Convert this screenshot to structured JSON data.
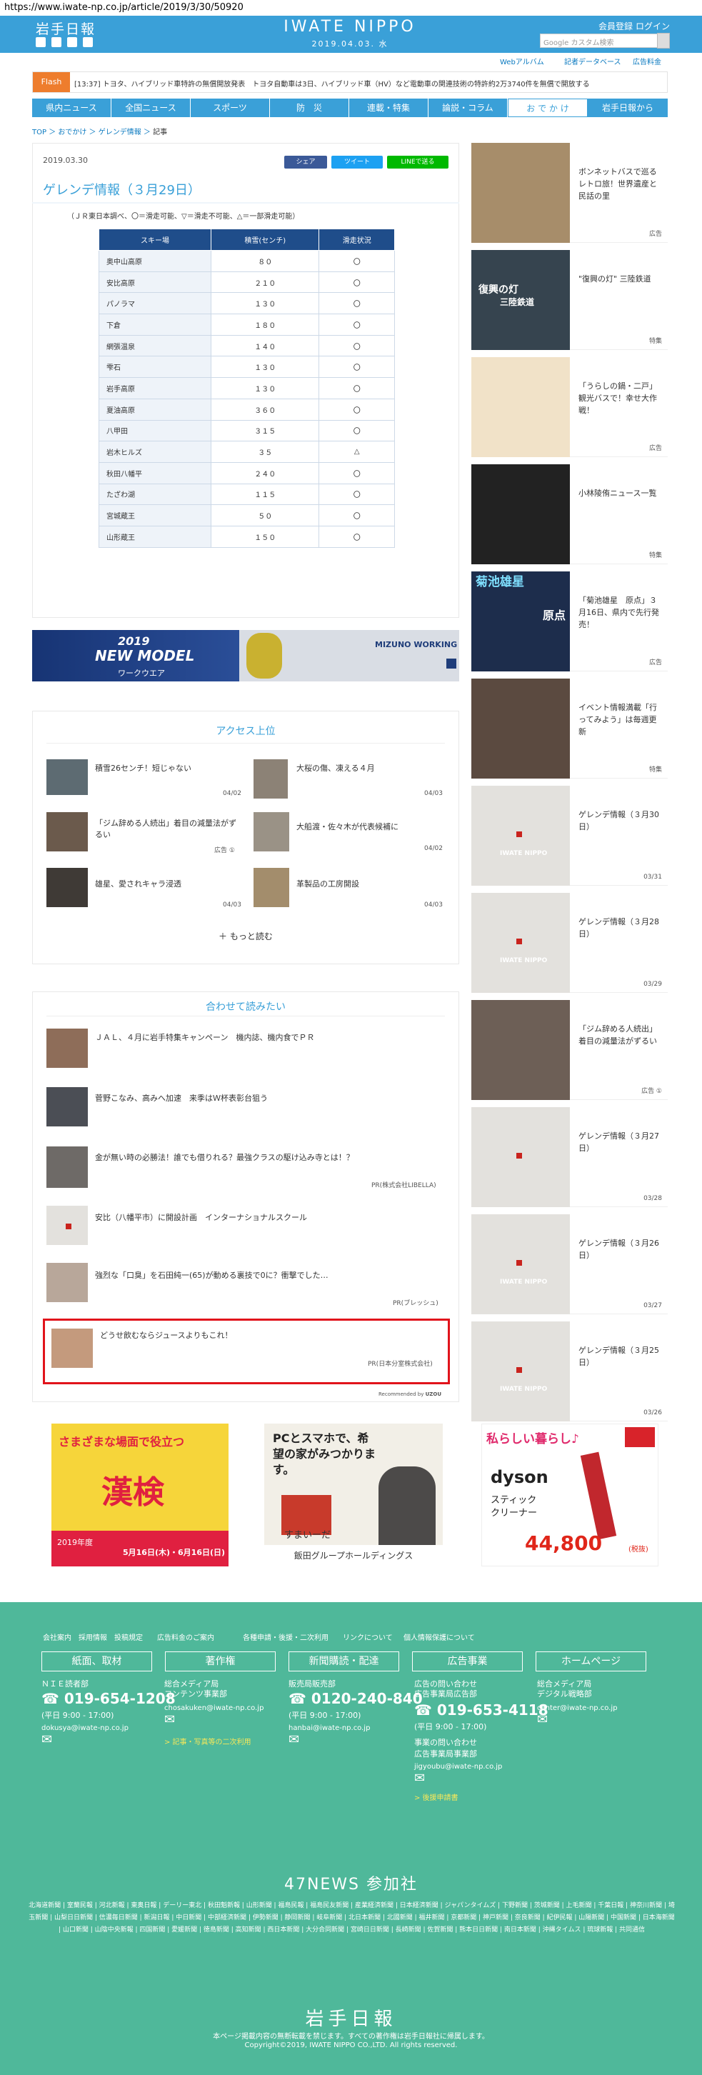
{
  "browser": {
    "url": "https://www.iwate-np.co.jp/article/2019/3/30/50920"
  },
  "header": {
    "logo": "岩手日報",
    "brand": "IWATE NIPPO",
    "date": "2019.04.03. 水",
    "register": "会員登録",
    "login": "ログイン",
    "search_placeholder": "Google カスタム検索",
    "subnav": [
      "Webアルバム",
      "記者データベース",
      "広告料金"
    ],
    "colors": {
      "primary": "#3aa0d8",
      "accent": "#ee7d2d",
      "footer": "#4fb89a",
      "highlight": "#e1131b"
    }
  },
  "flash": {
    "label": "Flash",
    "text": "[13:37] トヨタ、ハイブリッド車特許の無償開放発表　トヨタ自動車は3日、ハイブリッド車（HV）など電動車の関連技術の特許約2万3740件を無償で開放する"
  },
  "gnav": [
    "県内ニュース",
    "全国ニュース",
    "スポーツ",
    "防　災",
    "連載・特集",
    "論説・コラム",
    "お で か け",
    "岩手日報から"
  ],
  "breadcrumb": [
    "TOP",
    "おでかけ",
    "ゲレンデ情報",
    "記事"
  ],
  "article": {
    "date": "2019.03.30",
    "share": [
      "シェア",
      "ツイート",
      "LINEで送る"
    ],
    "title": "ゲレンデ情報（３月29日）",
    "note": "（ＪＲ東日本調べ、〇＝滑走可能、▽＝滑走不可能、△＝一部滑走可能）",
    "table": {
      "headers": [
        "スキー場",
        "積雪(センチ)",
        "滑走状況"
      ],
      "rows": [
        [
          "奥中山高原",
          "８０",
          "〇"
        ],
        [
          "安比高原",
          "２１０",
          "〇"
        ],
        [
          "パノラマ",
          "１３０",
          "〇"
        ],
        [
          "下倉",
          "１８０",
          "〇"
        ],
        [
          "網張温泉",
          "１４０",
          "〇"
        ],
        [
          "雫石",
          "１３０",
          "〇"
        ],
        [
          "岩手高原",
          "１３０",
          "〇"
        ],
        [
          "夏油高原",
          "３６０",
          "〇"
        ],
        [
          "八甲田",
          "３１５",
          "〇"
        ],
        [
          "岩木ヒルズ",
          "３５",
          "△"
        ],
        [
          "秋田八幡平",
          "２４０",
          "〇"
        ],
        [
          "たざわ湖",
          "１１５",
          "〇"
        ],
        [
          "宮城蔵王",
          "５０",
          "〇"
        ],
        [
          "山形蔵王",
          "１５０",
          "〇"
        ]
      ]
    }
  },
  "ad_banner": {
    "line1": "2019",
    "line2": "NEW MODEL",
    "line3": "ワークウエア",
    "brand": "MIZUNO WORKING"
  },
  "access": {
    "title": "アクセス上位",
    "items": [
      {
        "text": "積雪26センチ！短じゃない",
        "date": "04/02"
      },
      {
        "text": "大桜の傷、凍える４月",
        "date": "04/03"
      },
      {
        "text": "「ジム辞める人続出」着目の減量法がずるい",
        "date": "広告 ①"
      },
      {
        "text": "大船渡・佐々木が代表候補に",
        "date": "04/02"
      },
      {
        "text": "雄星、愛されキャラ浸透",
        "date": "04/03"
      },
      {
        "text": "革製品の工房開設",
        "date": "04/03"
      }
    ],
    "more": "もっと読む"
  },
  "related": {
    "title": "合わせて読みたい",
    "items": [
      {
        "text": "ＪＡＬ、４月に岩手特集キャンペーン　機内誌、機内食でＰＲ",
        "src": ""
      },
      {
        "text": "菅野こなみ、高みへ加速　来季はＷ杯表彰台狙う",
        "src": ""
      },
      {
        "text": "金が無い時の必勝法！誰でも借りれる？最強クラスの駆け込み寺とは！？",
        "src": "PR(株式会社LIBELLA)"
      },
      {
        "text": "安比（八幡平市）に開設計画　インターナショナルスクール",
        "src": ""
      },
      {
        "text": "強烈な「口臭」を石田純一(65)が動める裏技で0に？衝撃でした…",
        "src": "PR(ブレッシュ)"
      },
      {
        "text": "どうせ飲むならジュースよりもこれ！",
        "src": "PR(日本分室株式会社)"
      }
    ],
    "recommended": "Recommended by",
    "recommended_brand": "UZOU"
  },
  "sidebar": [
    {
      "text": "ボンネットバスで巡るレトロ旅！世界遺産と民話の里",
      "tag": "広告"
    },
    {
      "text": "\"復興の灯\" 三陸鉄道",
      "tag": "特集"
    },
    {
      "text": "「うらしの鍋・二戸」観光バスで！幸せ大作戦！",
      "tag": "広告"
    },
    {
      "text": "小林陵侑ニュース一覧",
      "tag": "特集"
    },
    {
      "text": "「菊池雄星　原点」３月16日、県内で先行発売！",
      "tag": "広告"
    },
    {
      "text": "イベント情報満載「行ってみよう」は毎週更新",
      "tag": "特集"
    },
    {
      "text": "ゲレンデ情報（３月30日）",
      "tag": "03/31"
    },
    {
      "text": "ゲレンデ情報（３月28日）",
      "tag": "03/29"
    },
    {
      "text": "「ジム辞める人続出」着目の減量法がずるい",
      "tag": "広告 ①"
    },
    {
      "text": "ゲレンデ情報（３月27日）",
      "tag": "03/28"
    },
    {
      "text": "ゲレンデ情報（３月26日）",
      "tag": "03/27"
    },
    {
      "text": "ゲレンデ情報（３月25日）",
      "tag": "03/26"
    }
  ],
  "sidebar_img_texts": {
    "sanriku": "復興の灯",
    "sanriku2": "三陸鉄道",
    "kikuchi": "菊池雄星",
    "genten": "原点",
    "placeholder": "IWATE NIPPO"
  },
  "bottom_ads": {
    "a1_title": "さまざまな場面で役立つ",
    "a1_big": "漢検",
    "a1_year": "2019年度",
    "a1_dates": "5月16日(木)・6月16日(日)",
    "a2_title": "PCとスマホで、希望の家がみつかります。",
    "a2_brand": "すまいーだ",
    "a2_company": "飯田グループホールディングス",
    "a3_title": "私らしい暮らし♪",
    "a3_brand": "dyson",
    "a3_product": "スティッククリーナー",
    "a3_price": "44,800",
    "a3_tax": "(税抜)"
  },
  "footer": {
    "links": [
      "会社案内",
      "採用情報",
      "投稿規定",
      "広告料金のご案内",
      "各種申請・後援・二次利用",
      "リンクについて",
      "個人情報保護について"
    ],
    "boxes": [
      "紙面、取材",
      "著作権",
      "新聞購読・配達",
      "広告事業",
      "ホームページ"
    ],
    "cols": [
      {
        "l1": "ＮＩＥ読者部",
        "phone": "019-654-1208",
        "hours": "(平日 9:00 - 17:00)",
        "mail": "dokusya@iwate-np.co.jp"
      },
      {
        "l1": "総合メディア局",
        "l2": "コンテンツ事業部",
        "mail": "chosakuken@iwate-np.co.jp",
        "link": "> 記事・写真等の二次利用"
      },
      {
        "l1": "販売局販売部",
        "phone": "0120-240-840",
        "hours": "(平日 9:00 - 17:00)",
        "mail": "hanbai@iwate-np.co.jp"
      },
      {
        "l1": "広告の問い合わせ",
        "l2": "広告事業局広告部",
        "phone": "019-653-4118",
        "hours": "(平日 9:00 - 17:00)",
        "l3": "事業の問い合わせ",
        "l4": "広告事業局事業部",
        "mail": "jigyoubu@iwate-np.co.jp",
        "link": "> 後援申請書"
      },
      {
        "l1": "総合メディア局",
        "l2": "デジタル戦略部",
        "mail": "center@iwate-np.co.jp"
      }
    ],
    "n47": "47NEWS 参加社",
    "papers": "北海道新聞 | 室蘭民報 | 河北新報 | 東奥日報 | デーリー東北 | 秋田魁新報 | 山形新聞 | 福島民報 | 福島民友新聞 | 産業経済新聞 | 日本経済新聞 | ジャパンタイムズ | 下野新聞 | 茨城新聞 | 上毛新聞 | 千葉日報 | 神奈川新聞 | 埼玉新聞 | 山梨日日新聞 | 信濃毎日新聞 | 新潟日報 | 中日新聞 | 中部経済新聞 | 伊勢新聞 | 静岡新聞 | 岐阜新聞 | 北日本新聞 | 北國新聞 | 福井新聞 | 京都新聞 | 神戸新聞 | 奈良新聞 | 紀伊民報 | 山陽新聞 | 中国新聞 | 日本海新聞 | 山口新聞 | 山陰中央新報 | 四国新聞 | 愛媛新聞 | 徳島新聞 | 高知新聞 | 西日本新聞 | 大分合同新聞 | 宮崎日日新聞 | 長崎新聞 | 佐賀新聞 | 熊本日日新聞 | 南日本新聞 | 沖縄タイムス | 琉球新報 | 共同通信",
    "logo": "岩手日報",
    "notice": "本ページ掲載内容の無断転載を禁じます。すべての著作権は岩手日報社に帰属します。",
    "copyright": "Copyright©2019, IWATE NIPPO CO.,LTD. All rights reserved."
  }
}
